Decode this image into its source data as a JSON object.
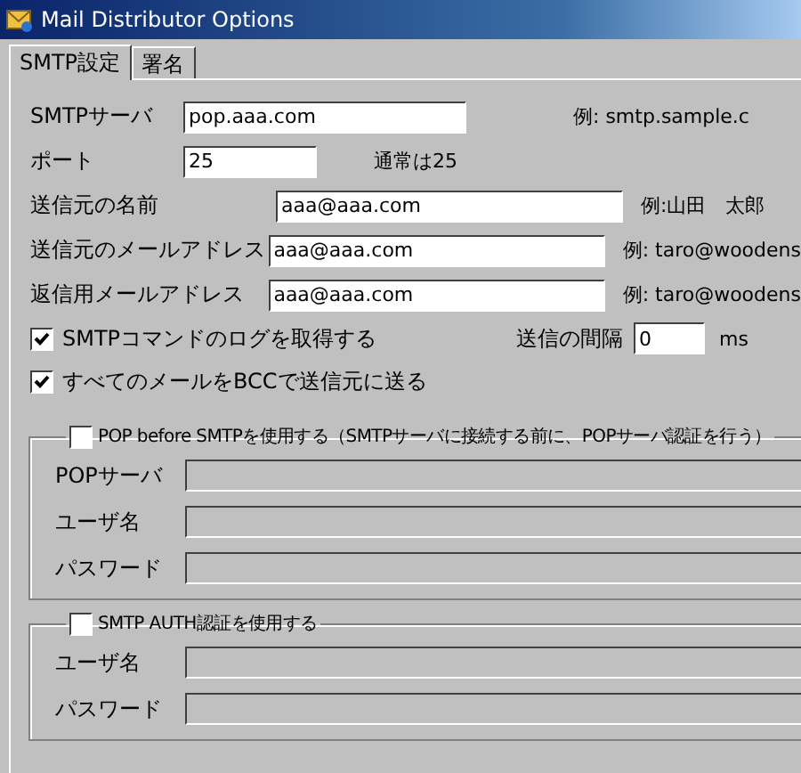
{
  "window": {
    "title": "Mail Distributor Options"
  },
  "tabs": [
    {
      "label": "SMTP設定",
      "selected": true
    },
    {
      "label": "署名",
      "selected": false
    }
  ],
  "fields": [
    {
      "kind": "server",
      "label": "SMTPサーバ",
      "value": "pop.aaa.com",
      "hint": "例: smtp.sample.c"
    },
    {
      "kind": "port",
      "label": "ポート",
      "value": "25",
      "hint": "通常は25"
    },
    {
      "kind": "sender",
      "label": "送信元の名前",
      "value": "aaa@aaa.com",
      "hint": "例:山田　太郎"
    },
    {
      "kind": "sender",
      "label": "送信元のメールアドレス",
      "value": "aaa@aaa.com",
      "hint": "例: taro@woodens"
    },
    {
      "kind": "sender",
      "label": "返信用メールアドレス",
      "value": "aaa@aaa.com",
      "hint": "例: taro@woodens"
    }
  ],
  "checkboxes": [
    {
      "label": "SMTPコマンドのログを取得する",
      "checked": true
    },
    {
      "label": "すべてのメールをBCCで送信元に送る",
      "checked": true
    }
  ],
  "interval": {
    "label": "送信の間隔",
    "value": "0",
    "unit": "ms"
  },
  "groups": [
    {
      "label": "POP before SMTPを使用する（SMTPサーバに接続する前に、POPサーバ認証を行う）",
      "checked": false,
      "fields": [
        {
          "label": "POPサーバ",
          "disabled": true
        },
        {
          "label": "ユーザ名",
          "disabled": true
        },
        {
          "label": "パスワード",
          "disabled": true
        }
      ]
    },
    {
      "label": "SMTP AUTH認証を使用する",
      "checked": false,
      "fields": [
        {
          "label": "ユーザ名",
          "disabled": true
        },
        {
          "label": "パスワード",
          "disabled": true
        }
      ]
    }
  ]
}
